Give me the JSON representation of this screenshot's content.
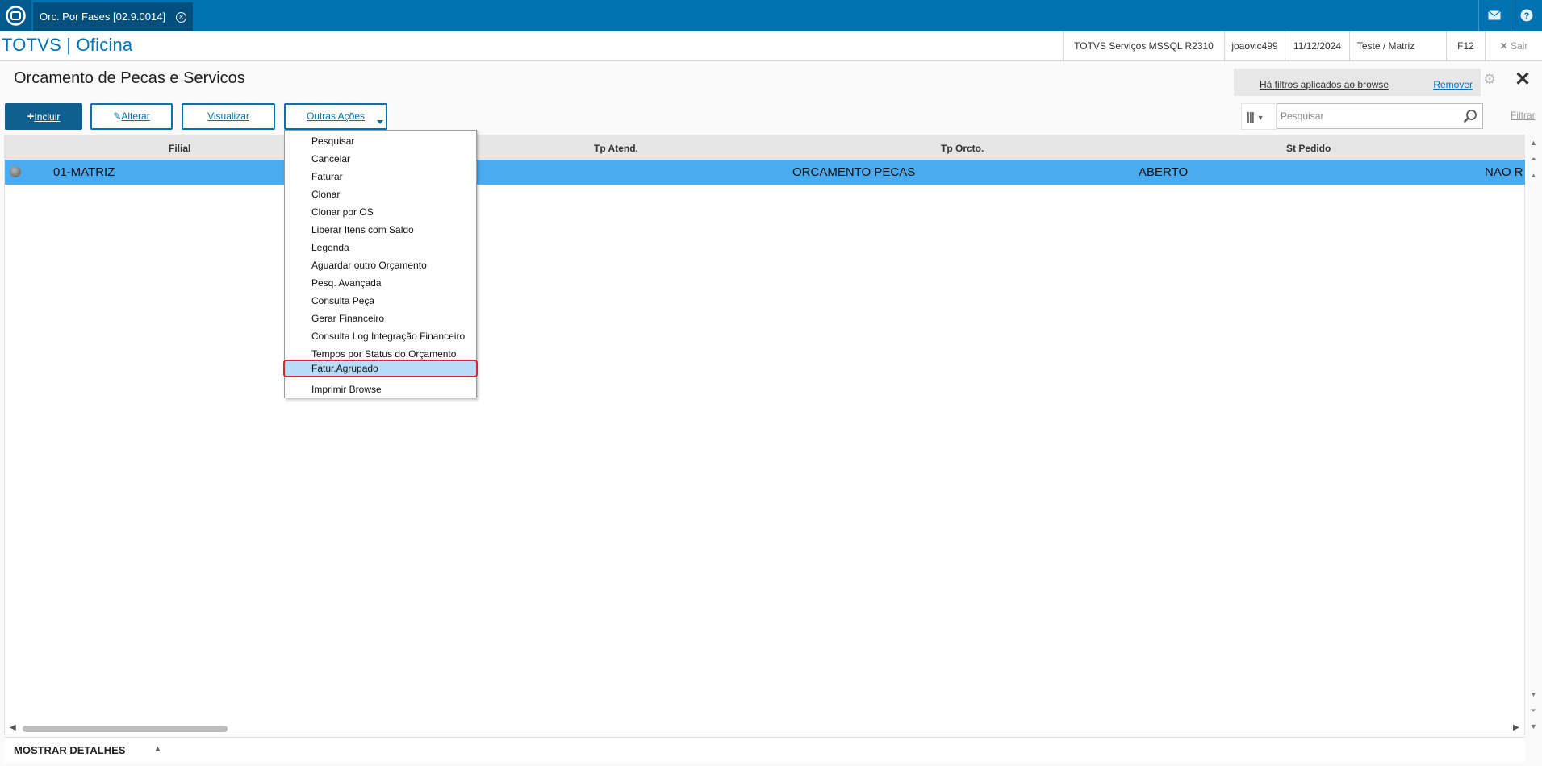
{
  "topbar": {
    "tab_title": "Orc. Por Fases [02.9.0014]",
    "icons": [
      "app-logo-icon",
      "close-icon",
      "mail-icon",
      "help-icon"
    ]
  },
  "header": {
    "brand": "TOTVS | Oficina",
    "server": "TOTVS Serviços MSSQL R2310",
    "user": "joaovic499",
    "date": "11/12/2024",
    "company": "Teste / Matriz",
    "f12": "F12",
    "logout": "Sair"
  },
  "page": {
    "title": "Orcamento de Pecas e Servicos",
    "filter_notice": "Há filtros aplicados ao browse",
    "remove_label": "Remover"
  },
  "toolbar": {
    "incluir": "Incluir",
    "alterar": "Alterar",
    "visualizar": "Visualizar",
    "outras_acoes": "Outras Ações",
    "search_placeholder": "Pesquisar",
    "filtrar": "Filtrar"
  },
  "grid": {
    "columns": [
      "Filial",
      "Tp Atend.",
      "Tp Orcto.",
      "St Pedido"
    ],
    "row": {
      "filial": "01-MATRIZ",
      "tp_orcto": "ORCAMENTO PECAS",
      "status": "ABERTO",
      "st_pedido": "NAO R"
    }
  },
  "menu": {
    "items": [
      "Pesquisar",
      "Cancelar",
      "Faturar",
      "Clonar",
      "Clonar por OS",
      "Liberar Itens com Saldo",
      "Legenda",
      "Aguardar outro Orçamento",
      "Pesq. Avançada",
      "Consulta Peça",
      "Gerar Financeiro",
      "Consulta Log Integração Financeiro",
      "Tempos por Status do Orçamento",
      "Fatur.Agrupado",
      "Imprimir Browse"
    ],
    "highlighted_index": 13
  },
  "footer": {
    "details_label": "MOSTRAR DETALHES"
  },
  "colors": {
    "primary": "#0072b1",
    "selected_row": "#4aabf1",
    "highlight_border": "#d9262c"
  }
}
